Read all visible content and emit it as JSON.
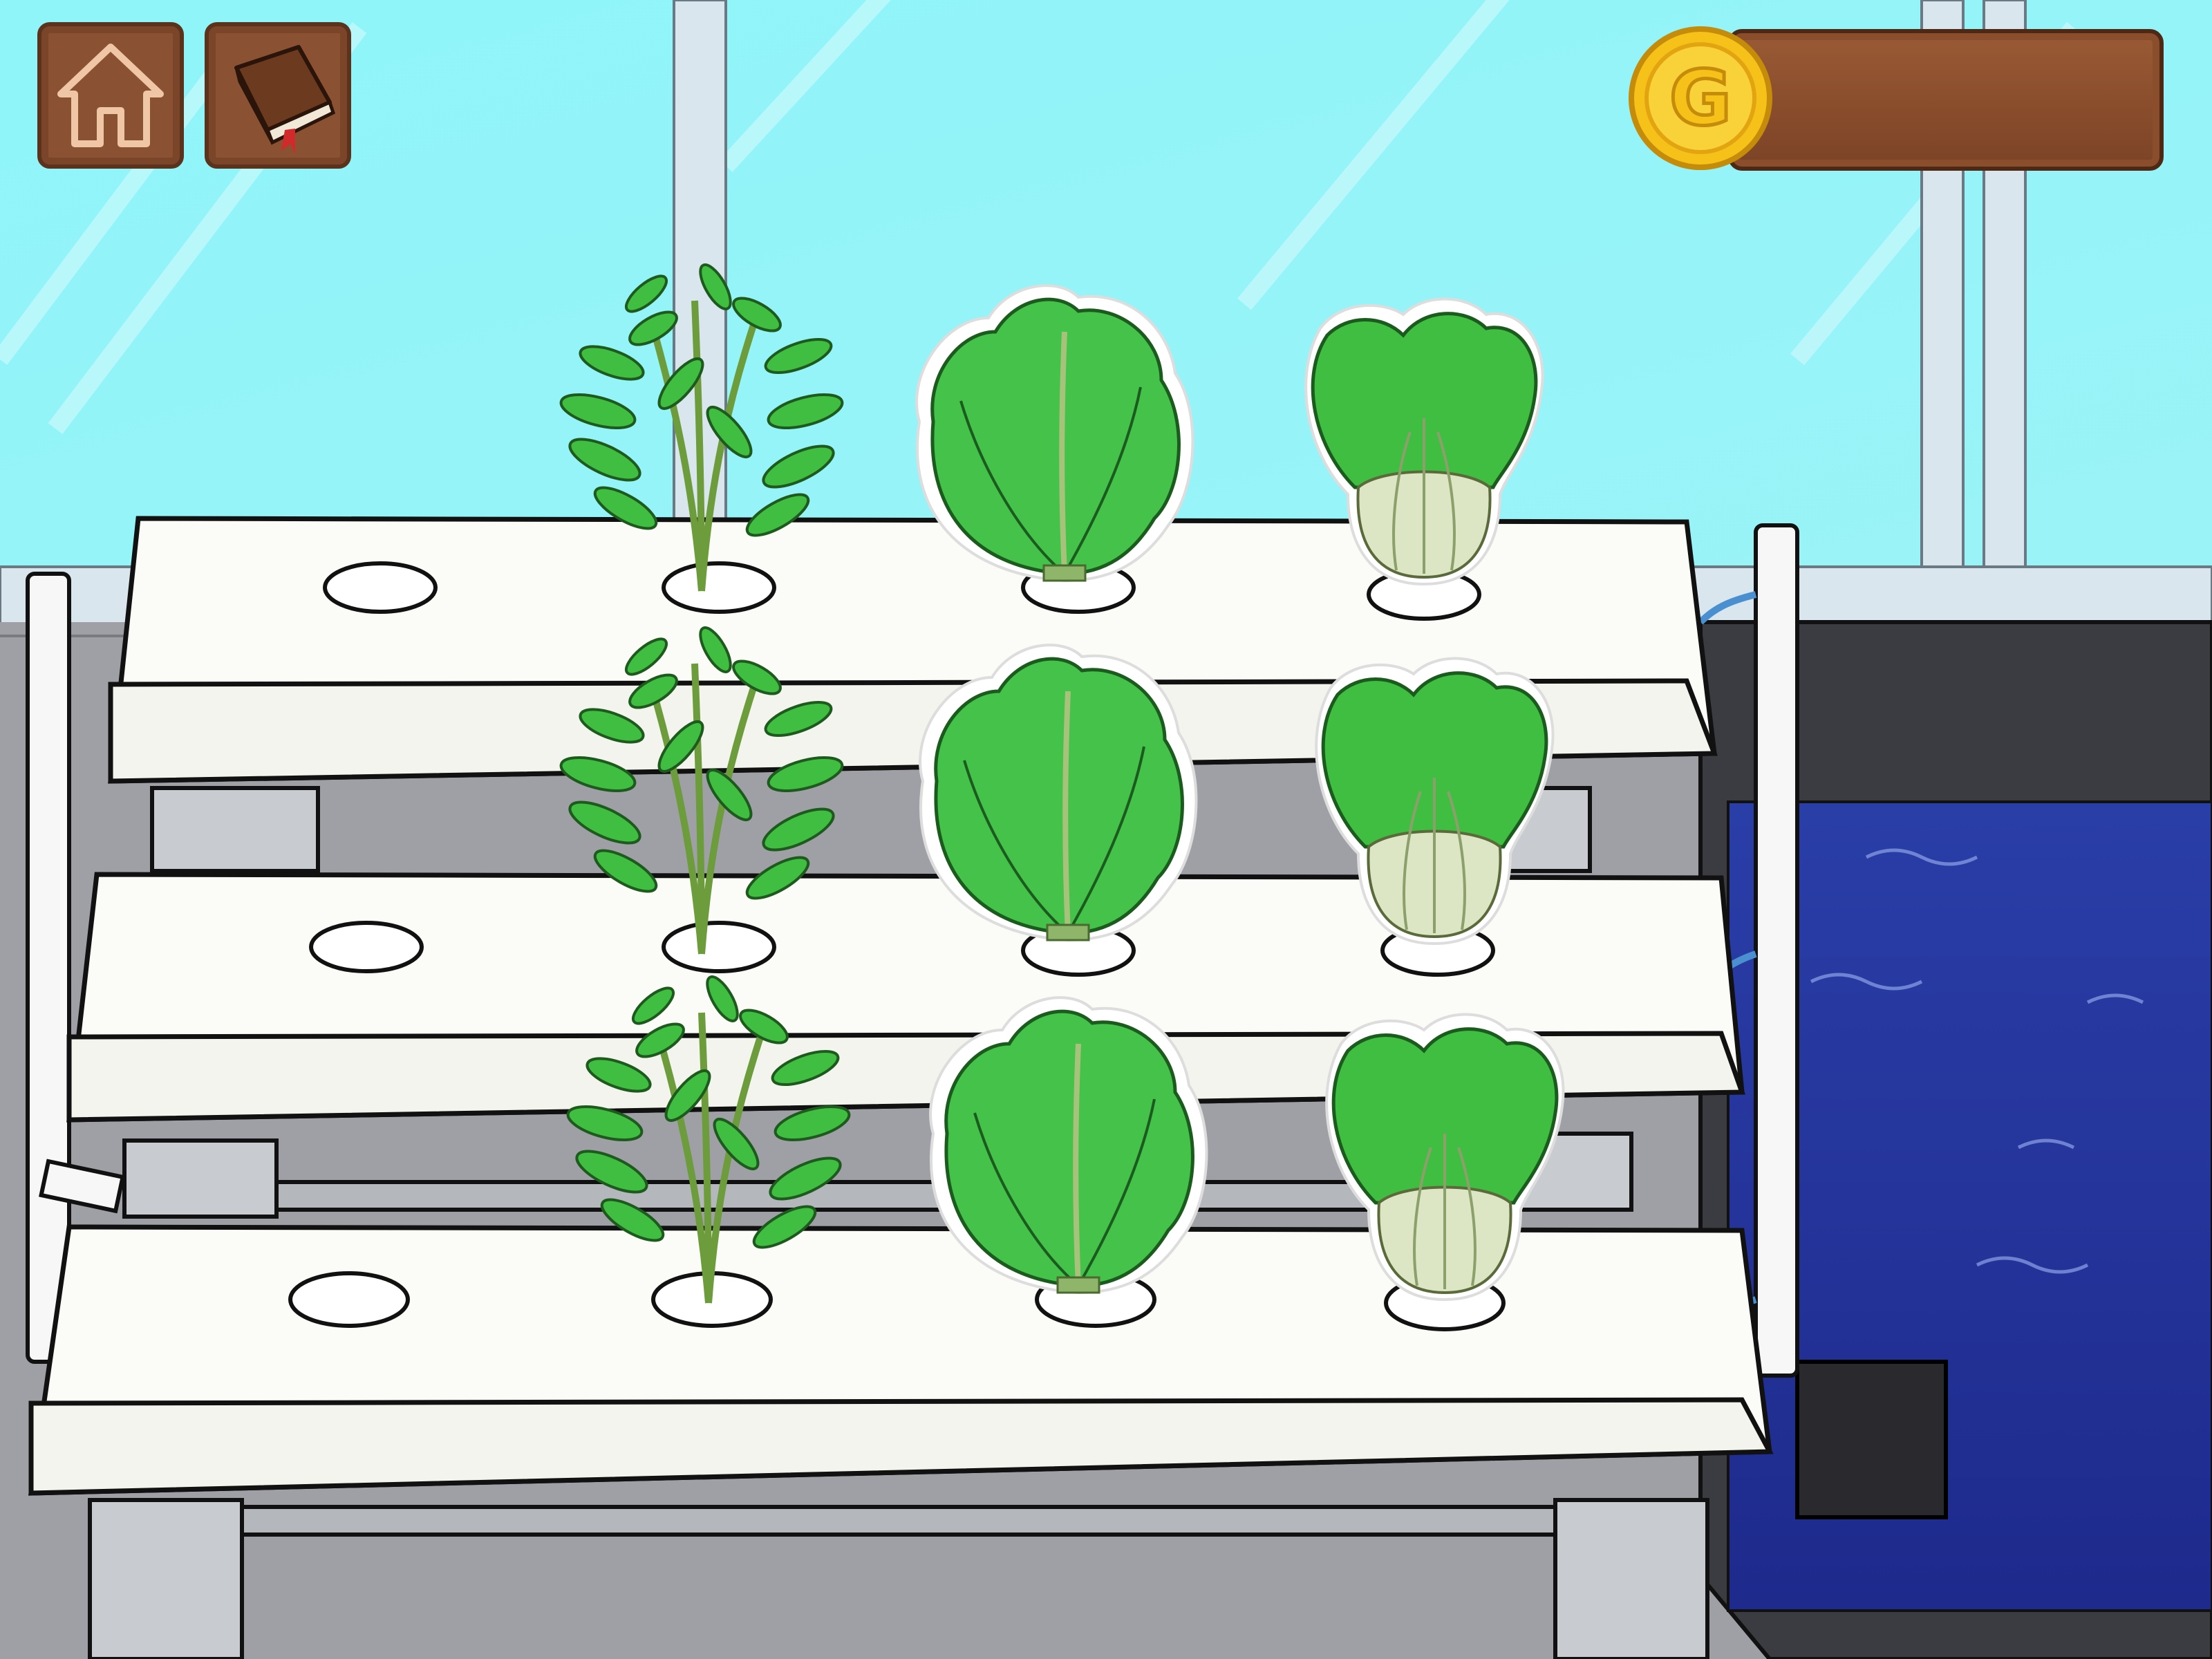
{
  "hud": {
    "home_icon": "home-icon",
    "book_icon": "book-icon",
    "coin_icon": "gold-coin-icon",
    "coin_symbol": "G",
    "coin_amount": ""
  },
  "colors": {
    "sky": "#8ff5f9",
    "floor": "#9fa0a6",
    "wood": "#8a5232",
    "coin_gold": "#f6c21a",
    "leaf_green": "#3fbe41",
    "water": "#23329a"
  },
  "garden": {
    "rows": 3,
    "columns": 4,
    "planting_holes": [
      [
        "empty",
        "herb",
        "romaine-lettuce",
        "bok-choy"
      ],
      [
        "empty",
        "herb",
        "romaine-lettuce",
        "bok-choy"
      ],
      [
        "empty",
        "herb",
        "romaine-lettuce",
        "bok-choy"
      ]
    ]
  }
}
